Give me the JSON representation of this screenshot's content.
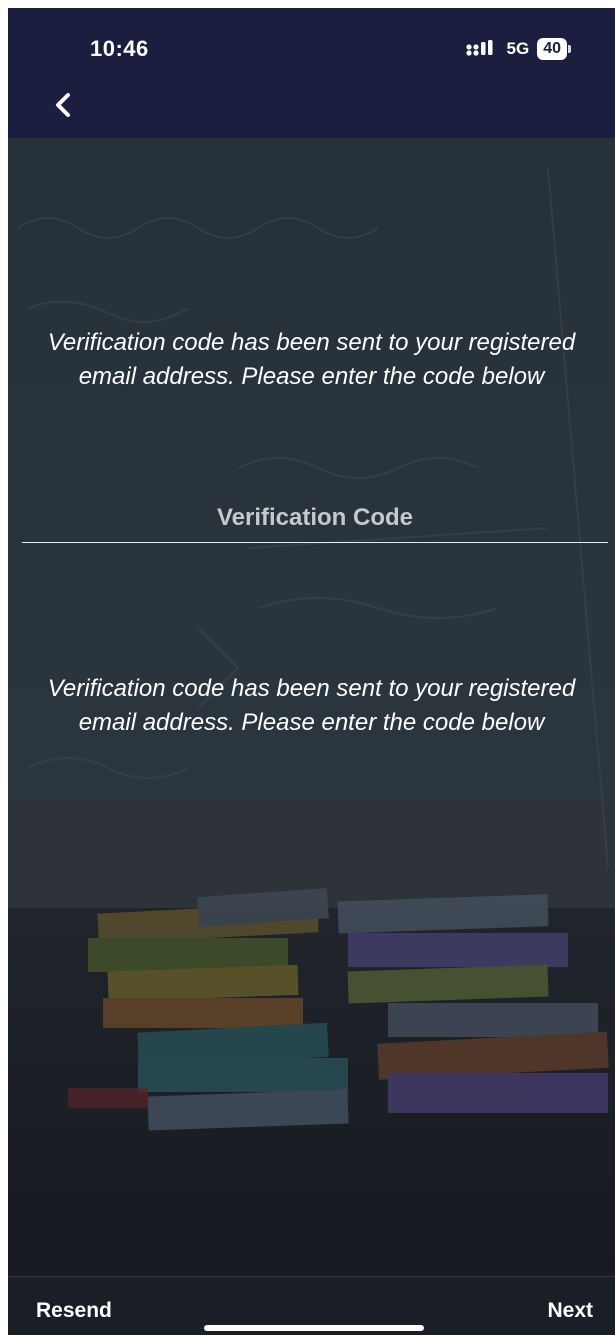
{
  "status_bar": {
    "time": "10:46",
    "network": "5G",
    "battery": "40",
    "icons": [
      "signal-icon",
      "battery-icon"
    ]
  },
  "header": {
    "back_icon": "chevron-left-icon"
  },
  "main": {
    "message_top": "Verification code has been sent to your registered email address. Please enter the code below",
    "code_placeholder": "Verification Code",
    "code_value": "",
    "message_bottom": "Verification code has been sent to your registered email address. Please enter the code below"
  },
  "bottom_bar": {
    "resend_label": "Resend",
    "next_label": "Next"
  },
  "colors": {
    "header_bg": "#1b1e3f",
    "text": "#ffffff",
    "placeholder": "#c6c8cf",
    "bottom_bar_bg": "#1a1e26"
  }
}
